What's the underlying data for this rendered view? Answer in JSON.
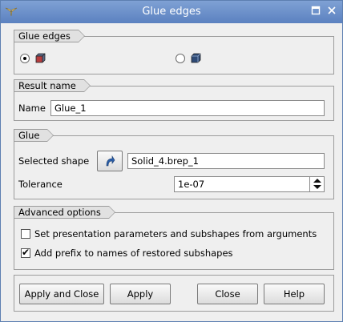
{
  "window": {
    "title": "Glue edges"
  },
  "groups": {
    "glue_edges": {
      "label": "Glue edges"
    },
    "result_name": {
      "label": "Result name",
      "name_label": "Name",
      "name_value": "Glue_1"
    },
    "glue": {
      "label": "Glue",
      "selected_shape_label": "Selected shape",
      "selected_shape_value": "Solid_4.brep_1",
      "tolerance_label": "Tolerance",
      "tolerance_value": "1e-07"
    },
    "advanced": {
      "label": "Advanced options",
      "set_presentation_label": "Set presentation parameters and subshapes from arguments",
      "set_presentation_checked": false,
      "add_prefix_label": "Add prefix to names of restored subshapes",
      "add_prefix_checked": true
    }
  },
  "buttons": {
    "apply_and_close": "Apply and Close",
    "apply": "Apply",
    "close": "Close",
    "help": "Help"
  },
  "icons": [
    "app-menu-icon",
    "maximize-icon",
    "close-icon",
    "box-solid-icon",
    "box-shape-icon",
    "select-arrow-icon",
    "spin-up-icon",
    "spin-down-icon"
  ]
}
